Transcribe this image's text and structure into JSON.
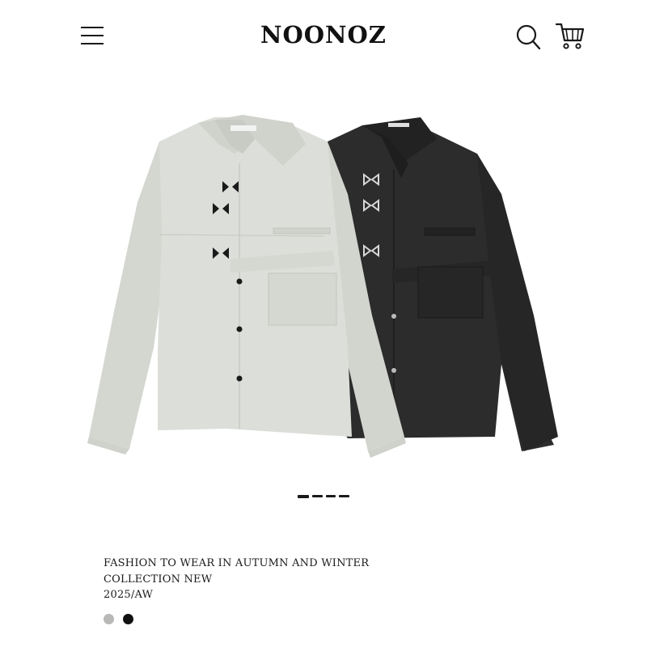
{
  "header": {
    "brand": "NOONOZ",
    "menu_icon": "hamburger-menu-icon",
    "search_icon": "search-icon",
    "cart_icon": "shopping-cart-icon"
  },
  "hero": {
    "products": [
      {
        "color_name": "light-gray",
        "fabric": "#d9dbd5"
      },
      {
        "color_name": "black",
        "fabric": "#2c2c2c"
      }
    ]
  },
  "carousel": {
    "slides": 4
  },
  "product": {
    "title_line1": "FASHION TO WEAR IN AUTUMN AND WINTER",
    "title_line2": "COLLECTION NEW",
    "season": "2025/AW"
  },
  "swatches": [
    {
      "name": "light-gray",
      "color": "#b8b8b6"
    },
    {
      "name": "black",
      "color": "#111111"
    }
  ]
}
